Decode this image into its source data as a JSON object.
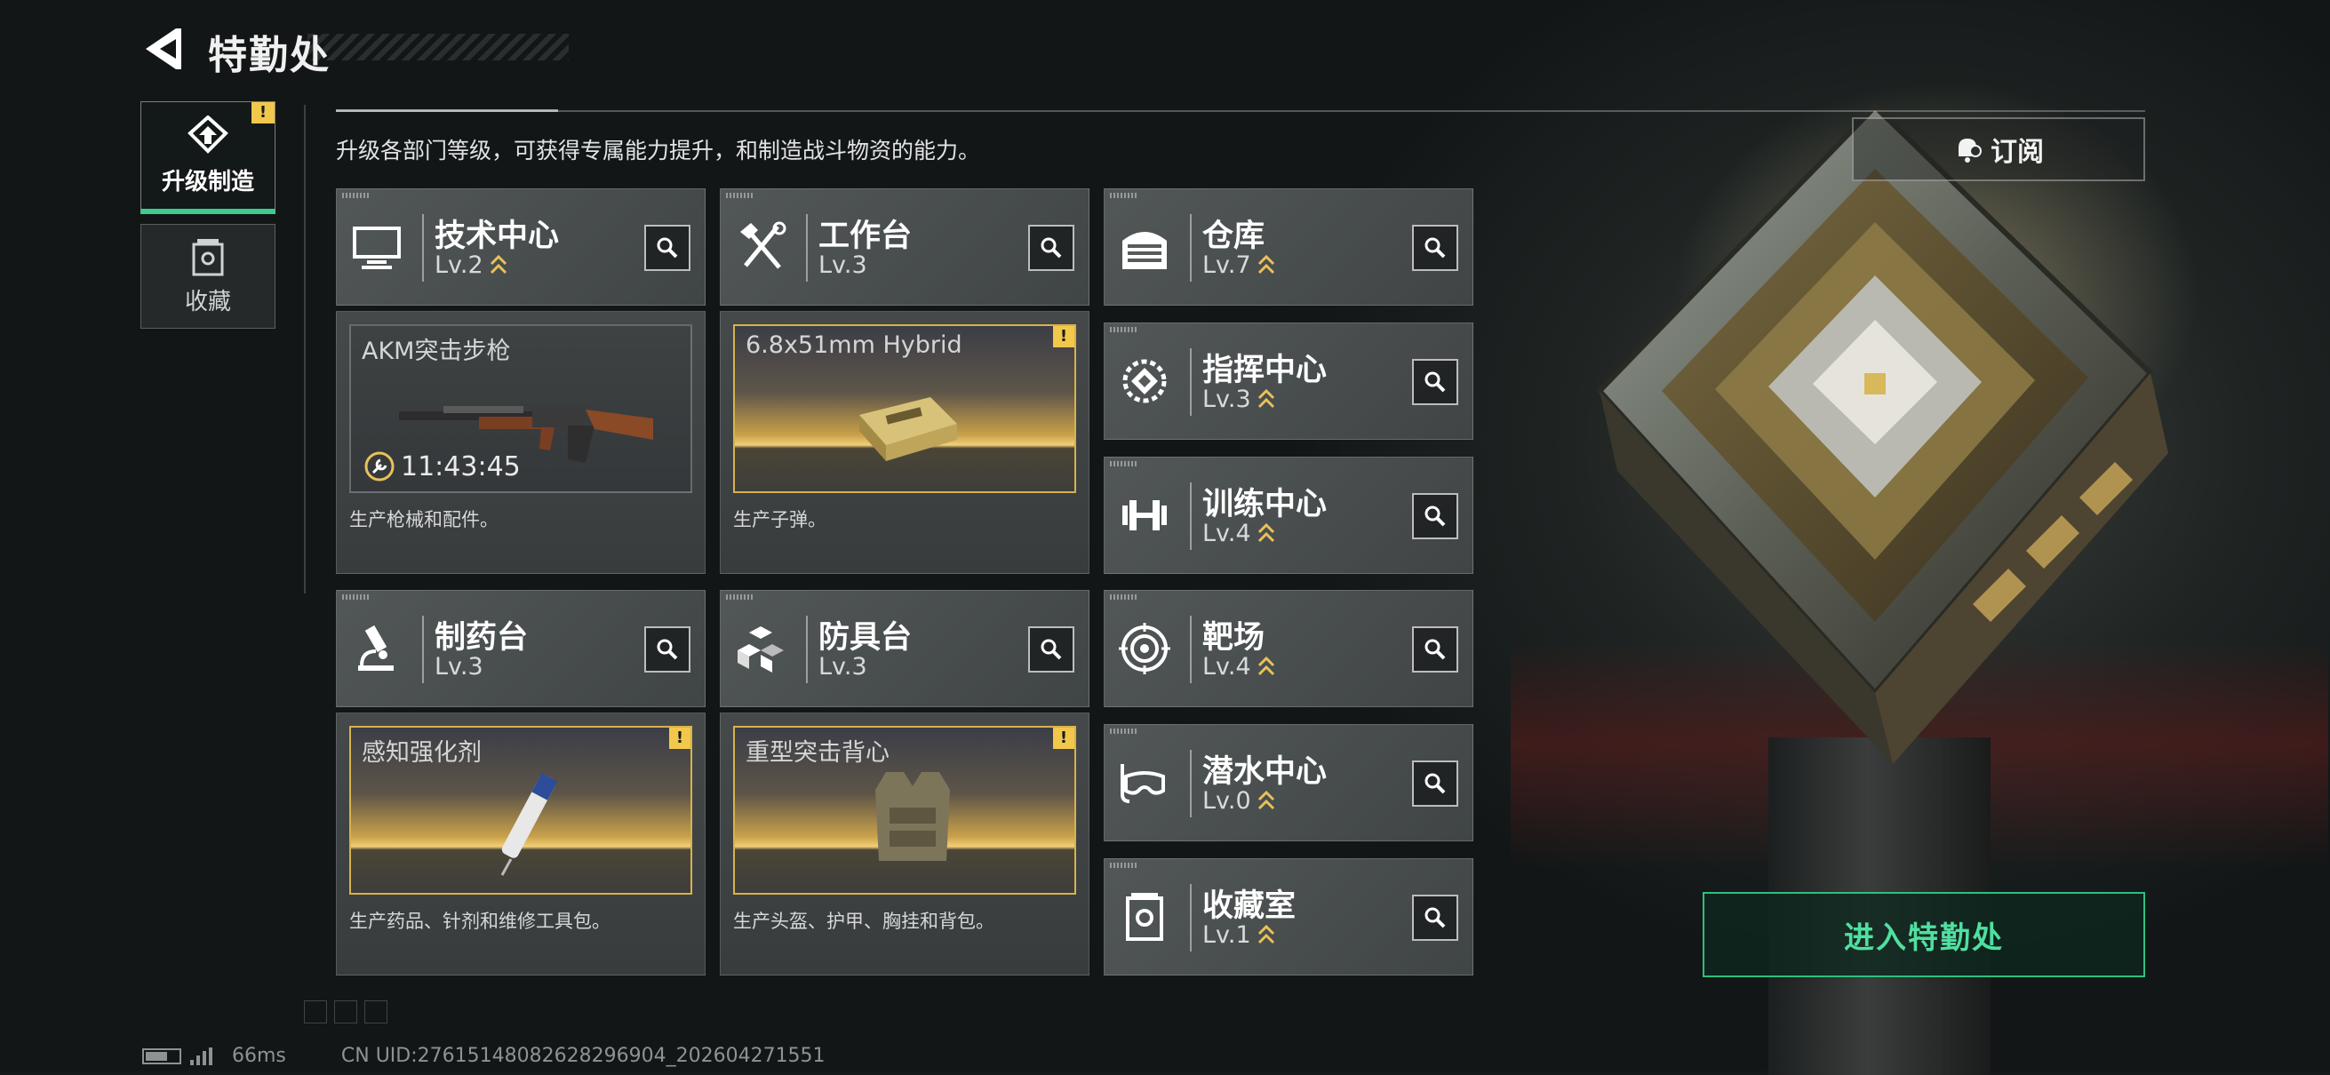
{
  "header": {
    "title": "特勤处"
  },
  "nav": [
    {
      "label": "升级制造",
      "active": true,
      "badge": "!"
    },
    {
      "label": "收藏",
      "active": false
    }
  ],
  "description": "升级各部门等级，可获得专属能力提升，和制造战斗物资的能力。",
  "subscribe_label": "订阅",
  "departments": {
    "tech": {
      "name": "技术中心",
      "level": "Lv.2",
      "upgradable": true,
      "icon": "monitor-icon",
      "production": {
        "item": "AKM突击步枪",
        "timer": "11:43:45",
        "alert": false
      },
      "desc": "生产枪械和配件。"
    },
    "workbench": {
      "name": "工作台",
      "level": "Lv.3",
      "upgradable": false,
      "icon": "tools-icon",
      "production": {
        "item": "6.8x51mm Hybrid",
        "alert": true
      },
      "desc": "生产子弹。"
    },
    "pharmacy": {
      "name": "制药台",
      "level": "Lv.3",
      "upgradable": false,
      "icon": "microscope-icon",
      "production": {
        "item": "感知强化剂",
        "alert": true
      },
      "desc": "生产药品、针剂和维修工具包。"
    },
    "armor": {
      "name": "防具台",
      "level": "Lv.3",
      "upgradable": false,
      "icon": "armor-cubes-icon",
      "production": {
        "item": "重型突击背心",
        "alert": true
      },
      "desc": "生产头盔、护甲、胸挂和背包。"
    },
    "warehouse": {
      "name": "仓库",
      "level": "Lv.7",
      "upgradable": true,
      "icon": "warehouse-icon"
    },
    "command": {
      "name": "指挥中心",
      "level": "Lv.3",
      "upgradable": true,
      "icon": "chip-icon"
    },
    "training": {
      "name": "训练中心",
      "level": "Lv.4",
      "upgradable": true,
      "icon": "dumbbell-icon"
    },
    "range": {
      "name": "靶场",
      "level": "Lv.4",
      "upgradable": true,
      "icon": "target-icon"
    },
    "diving": {
      "name": "潜水中心",
      "level": "Lv.0",
      "upgradable": true,
      "icon": "diving-mask-icon"
    },
    "collection": {
      "name": "收藏室",
      "level": "Lv.1",
      "upgradable": true,
      "icon": "trophy-icon"
    }
  },
  "enter_label": "进入特勤处",
  "footer": {
    "ping": "66ms",
    "uid": "CN UID:27615148082628296904_202604271551"
  },
  "colors": {
    "accent_green": "#3ecb8e",
    "alert_yellow": "#f2c84b",
    "gold_frame": "#d9b24c"
  }
}
